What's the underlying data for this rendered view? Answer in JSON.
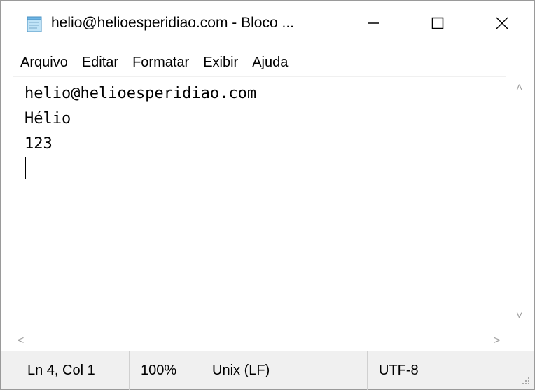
{
  "window": {
    "title": "helio@helioesperidiao.com - Bloco ...",
    "app_icon": "notepad-icon"
  },
  "caption_buttons": {
    "minimize_icon": "minimize-icon",
    "maximize_icon": "maximize-icon",
    "close_icon": "close-icon"
  },
  "menu": {
    "items": [
      {
        "label": "Arquivo"
      },
      {
        "label": "Editar"
      },
      {
        "label": "Formatar"
      },
      {
        "label": "Exibir"
      },
      {
        "label": "Ajuda"
      }
    ]
  },
  "editor": {
    "lines": [
      "helio@helioesperidiao.com",
      "Hélio",
      "123"
    ]
  },
  "scrollbars": {
    "up_arrow": "˄",
    "down_arrow": "˅",
    "left_arrow": "<",
    "right_arrow": ">"
  },
  "status": {
    "position": "Ln 4, Col 1",
    "zoom": "100%",
    "line_ending": "Unix (LF)",
    "encoding": "UTF-8"
  },
  "colors": {
    "statusbar_bg": "#f0f0f0",
    "text": "#000000",
    "scroll_arrow": "#a0a0a0"
  }
}
